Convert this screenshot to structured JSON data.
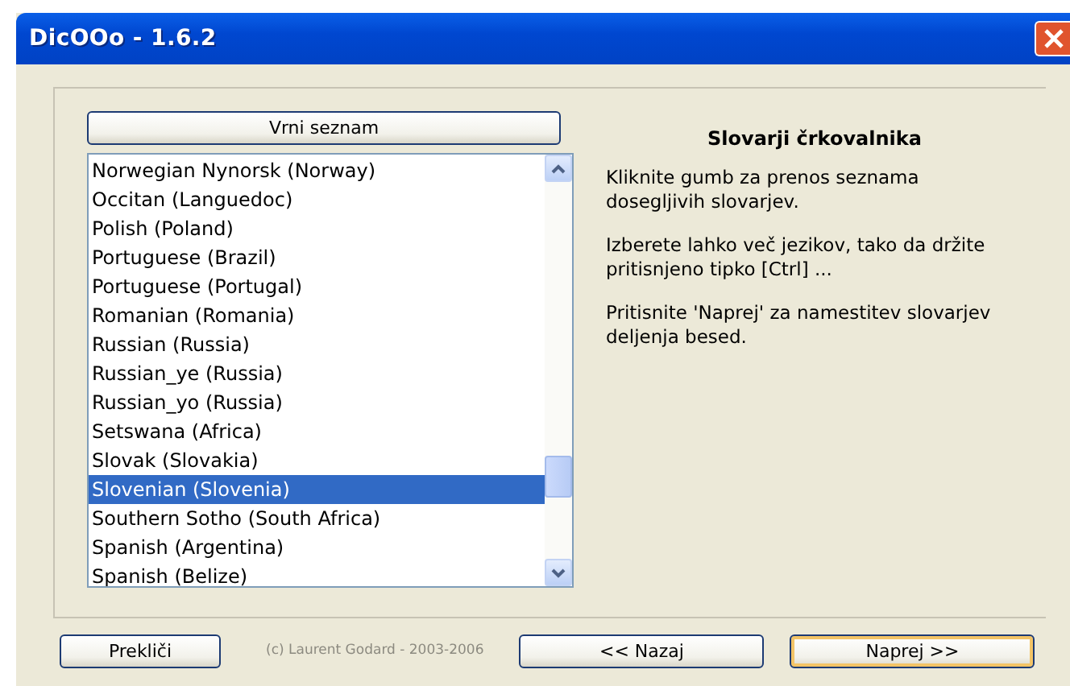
{
  "window": {
    "title": "DicOOo - 1.6.2"
  },
  "list_button": "Vrni seznam",
  "languages": [
    {
      "label": "Norwegian Nynorsk (Norway)",
      "selected": false
    },
    {
      "label": "Occitan (Languedoc)",
      "selected": false
    },
    {
      "label": "Polish (Poland)",
      "selected": false
    },
    {
      "label": "Portuguese (Brazil)",
      "selected": false
    },
    {
      "label": "Portuguese (Portugal)",
      "selected": false
    },
    {
      "label": "Romanian (Romania)",
      "selected": false
    },
    {
      "label": "Russian (Russia)",
      "selected": false
    },
    {
      "label": "Russian_ye (Russia)",
      "selected": false
    },
    {
      "label": "Russian_yo (Russia)",
      "selected": false
    },
    {
      "label": "Setswana (Africa)",
      "selected": false
    },
    {
      "label": "Slovak (Slovakia)",
      "selected": false
    },
    {
      "label": "Slovenian (Slovenia)",
      "selected": true
    },
    {
      "label": "Southern Sotho (South Africa)",
      "selected": false
    },
    {
      "label": "Spanish (Argentina)",
      "selected": false
    },
    {
      "label": "Spanish (Belize)",
      "selected": false
    }
  ],
  "info": {
    "heading": "Slovarji črkovalnika",
    "paragraphs": [
      "Kliknite gumb za prenos seznama dosegljivih slovarjev.",
      "Izberete lahko več jezikov, tako da držite pritisnjeno tipko [Ctrl] ...",
      "Pritisnite 'Naprej' za namestitev slovarjev deljenja besed."
    ]
  },
  "cancel_button": "Prekliči",
  "copyright": "(c) Laurent Godard - 2003-2006",
  "back_button": "<< Nazaj",
  "next_button": "Naprej >>"
}
